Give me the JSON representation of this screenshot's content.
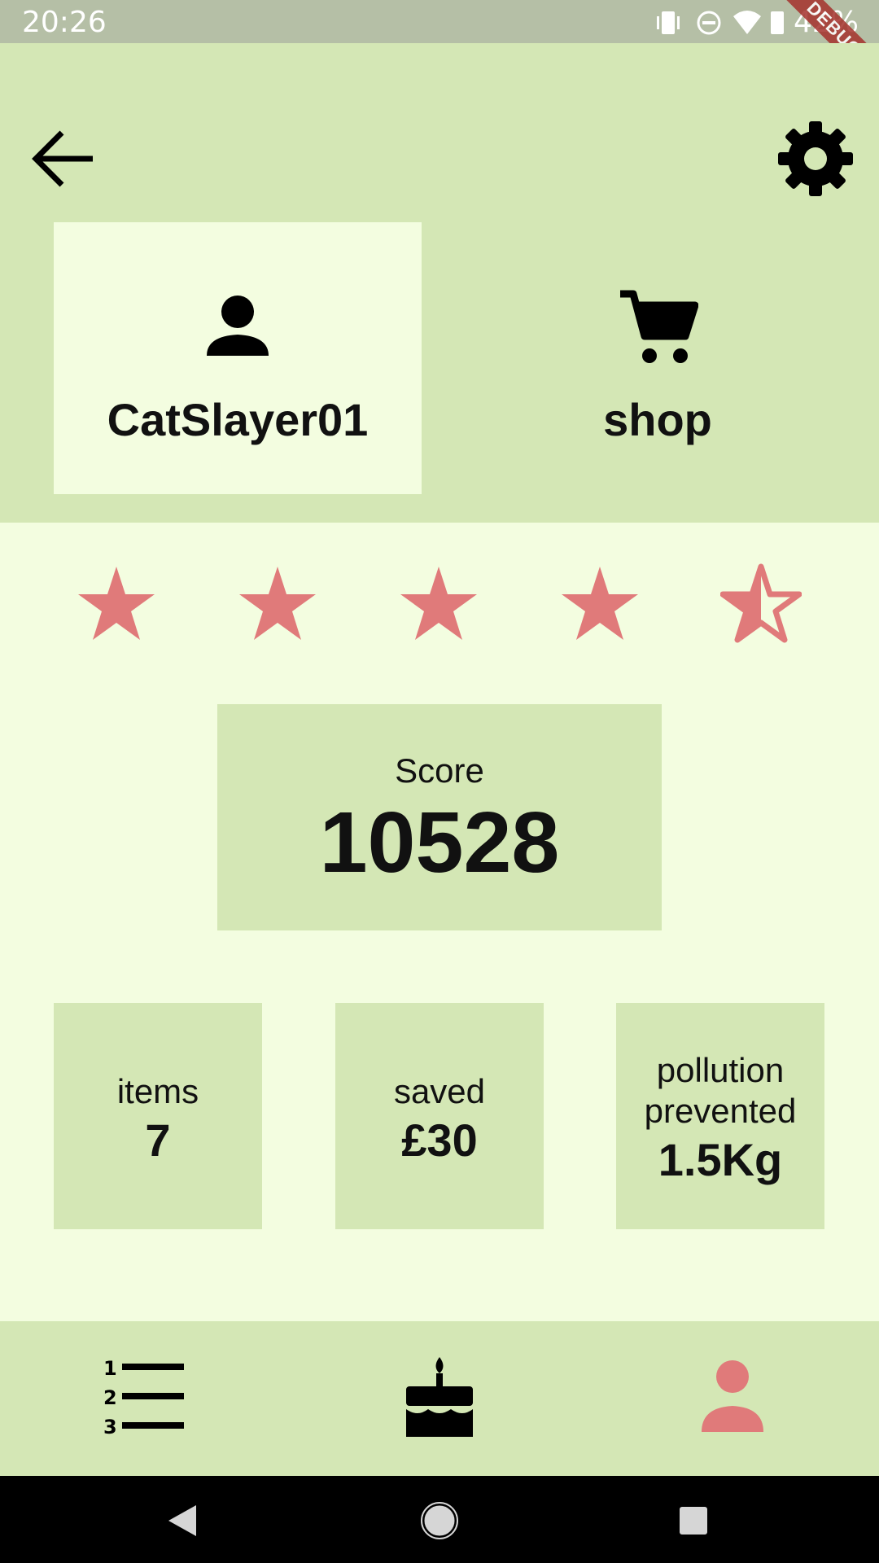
{
  "status_bar": {
    "time": "20:26",
    "battery_percent": "42%",
    "debug_label": "DEBUG"
  },
  "header": {
    "back_icon": "arrow-left-icon",
    "settings_icon": "gear-icon",
    "profile_tile": {
      "label": "CatSlayer01",
      "icon": "person-icon"
    },
    "shop_tile": {
      "label": "shop",
      "icon": "cart-icon"
    }
  },
  "rating": {
    "value": 4.5,
    "max": 5,
    "color": "#e07a7a"
  },
  "score": {
    "label": "Score",
    "value": "10528"
  },
  "stats": [
    {
      "label": "items",
      "value": "7"
    },
    {
      "label": "saved",
      "value": "£30"
    },
    {
      "label": "pollution prevented",
      "value": "1.5Kg"
    }
  ],
  "bottom_nav": {
    "items": [
      {
        "name": "leaderboard",
        "icon": "numbered-list-icon",
        "active": false
      },
      {
        "name": "events",
        "icon": "cake-icon",
        "active": false
      },
      {
        "name": "profile",
        "icon": "person-icon",
        "active": true
      }
    ],
    "active_color": "#e07a7a"
  },
  "colors": {
    "header_bg": "#d4e7b5",
    "page_bg": "#f3fde0",
    "accent": "#e07a7a"
  }
}
